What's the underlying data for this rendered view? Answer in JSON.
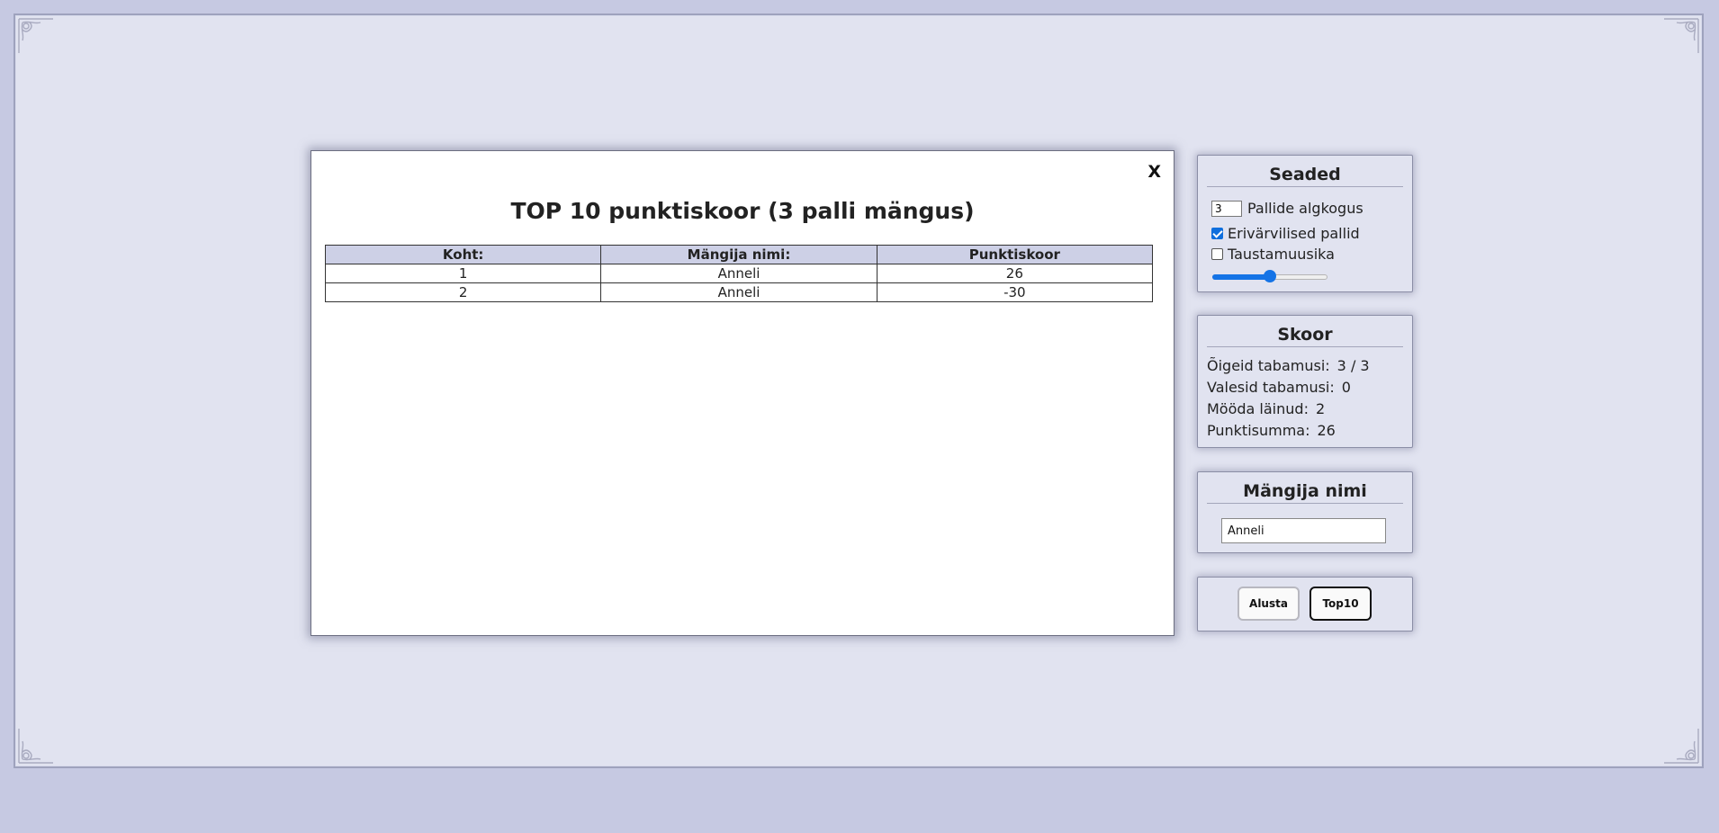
{
  "modal": {
    "close_label": "X",
    "title": "TOP 10 punktiskoor (3 palli mängus)",
    "columns": [
      "Koht:",
      "Mängija nimi:",
      "Punktiskoor"
    ],
    "rows": [
      [
        "1",
        "Anneli",
        "26"
      ],
      [
        "2",
        "Anneli",
        "-30"
      ]
    ]
  },
  "settings": {
    "title": "Seaded",
    "ball_count_value": "3",
    "ball_count_label": "Pallide algkogus",
    "colored_balls_label": "Erivärvilised pallid",
    "colored_balls_checked": true,
    "music_label": "Taustamuusika",
    "music_checked": false,
    "volume_fraction": 0.5
  },
  "score": {
    "title": "Skoor",
    "correct_label": "Õigeid tabamusi:",
    "correct_value": "3 / 3",
    "wrong_label": "Valesid tabamusi:",
    "wrong_value": "0",
    "missed_label": "Mööda läinud:",
    "missed_value": "2",
    "total_label": "Punktisumma:",
    "total_value": "26"
  },
  "player": {
    "title": "Mängija nimi",
    "name_value": "Anneli"
  },
  "buttons": {
    "start_label": "Alusta",
    "top10_label": "Top10"
  },
  "colors": {
    "page_bg": "#c6c9e2",
    "frame_bg": "#e1e3f0",
    "accent": "#1473e6",
    "table_header_bg": "#cdd0e6"
  }
}
